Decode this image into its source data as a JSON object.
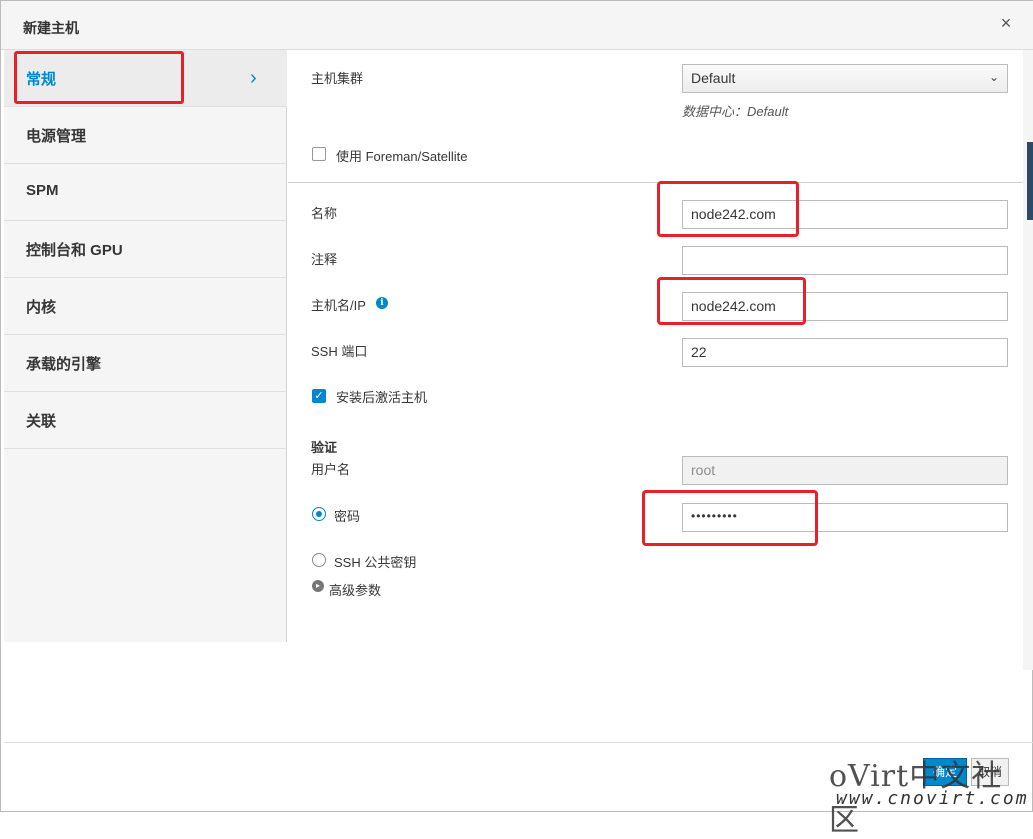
{
  "dialog": {
    "title": "新建主机",
    "close_glyph": "×"
  },
  "sidebar": {
    "items": [
      {
        "label": "常规"
      },
      {
        "label": "电源管理"
      },
      {
        "label": "SPM"
      },
      {
        "label": "控制台和 GPU"
      },
      {
        "label": "内核"
      },
      {
        "label": "承载的引擎"
      },
      {
        "label": "关联"
      }
    ],
    "active_chevron": "›"
  },
  "form": {
    "cluster_label": "主机集群",
    "cluster_value": "Default",
    "datacenter_note": "数据中心：Default",
    "foreman_label": "使用 Foreman/Satellite",
    "name_label": "名称",
    "name_value": "node242.com",
    "comment_label": "注释",
    "comment_value": "",
    "hostname_label": "主机名/IP",
    "hostname_value": "node242.com",
    "ssh_port_label": "SSH 端口",
    "ssh_port_value": "22",
    "activate_label": "安装后激活主机",
    "auth_heading": "验证",
    "username_label": "用户名",
    "username_value": "root",
    "password_label": "密码",
    "password_value": "•••••••••",
    "sshkey_label": "SSH 公共密钥",
    "advanced_label": "高级参数"
  },
  "footer": {
    "ok_label": "确定",
    "cancel_label": "取消"
  },
  "watermark": {
    "text": "oVirt中文社区",
    "url": "www.cnovirt.com"
  },
  "colors": {
    "accent": "#0088ce",
    "highlight": "#e8202a"
  }
}
